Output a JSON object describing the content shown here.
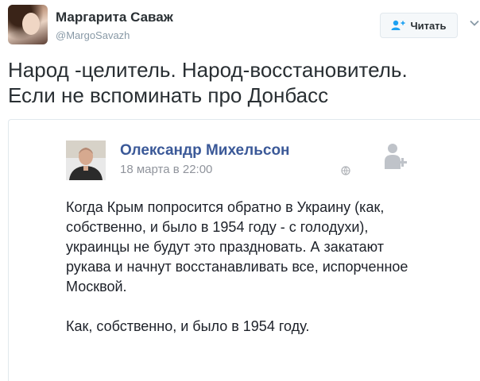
{
  "tweet": {
    "author_name": "Маргарита Саваж",
    "author_handle": "@MargoSavazh",
    "follow_label": "Читать",
    "text_line1": "Народ -целитель. Народ-восстановитель.",
    "text_line2": "Если не вспоминать про Донбасс"
  },
  "quoted_post": {
    "author_name": "Олександр Михельсон",
    "date": "18 марта в 22:00",
    "paragraph1": "Когда Крым попросится обратно в Украину (как, собственно, и было в 1954 году - с голодухи), украинцы не будут это праздновать. А закатают рукава и начнут восстанавливать все, испорченное Москвой.",
    "paragraph2": "Как, собственно, и было в 1954 году."
  },
  "icons": {
    "follow": "add-user-icon",
    "more": "chevron-down-icon",
    "privacy": "globe-icon",
    "add_friend": "add-friend-icon"
  },
  "colors": {
    "fb_name": "#3b5998",
    "handle": "#8899a6",
    "text": "#292f33"
  }
}
